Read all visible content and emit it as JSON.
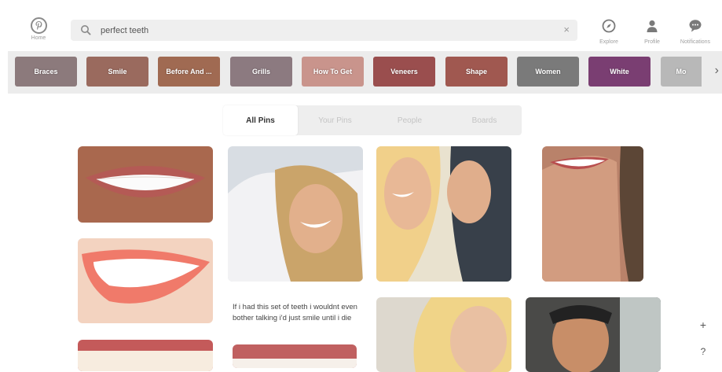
{
  "header": {
    "logo_label": "Home",
    "search": {
      "value": "perfect teeth",
      "placeholder": ""
    },
    "clear_symbol": "×",
    "nav": [
      {
        "label": "Explore",
        "icon": "compass-icon"
      },
      {
        "label": "Profile",
        "icon": "user-icon"
      },
      {
        "label": "Notifications",
        "icon": "speech-bubble-icon"
      }
    ]
  },
  "categories": [
    {
      "label": "Braces",
      "color": "#8c7a7c"
    },
    {
      "label": "Smile",
      "color": "#9a6a5e"
    },
    {
      "label": "Before And ...",
      "color": "#a06a52"
    },
    {
      "label": "Grills",
      "color": "#8c7a80"
    },
    {
      "label": "How To Get",
      "color": "#c9948c"
    },
    {
      "label": "Veneers",
      "color": "#9a4e4e"
    },
    {
      "label": "Shape",
      "color": "#a05850"
    },
    {
      "label": "Women",
      "color": "#7a7a7a"
    },
    {
      "label": "White",
      "color": "#7a3e72"
    },
    {
      "label": "Mo",
      "color": "#b8b8b8"
    }
  ],
  "tabs": [
    {
      "label": "All Pins",
      "active": true
    },
    {
      "label": "Your Pins",
      "active": false
    },
    {
      "label": "People",
      "active": false
    },
    {
      "label": "Boards",
      "active": false
    }
  ],
  "pins": {
    "caption": "If i had this set of teeth i wouldnt even bother talking i'd just smile until i die"
  },
  "floating": {
    "add": "+",
    "help": "?"
  },
  "colors": {
    "accent": "#7a3e72",
    "search_bg": "#efefef",
    "strip_bg": "#ececec"
  }
}
